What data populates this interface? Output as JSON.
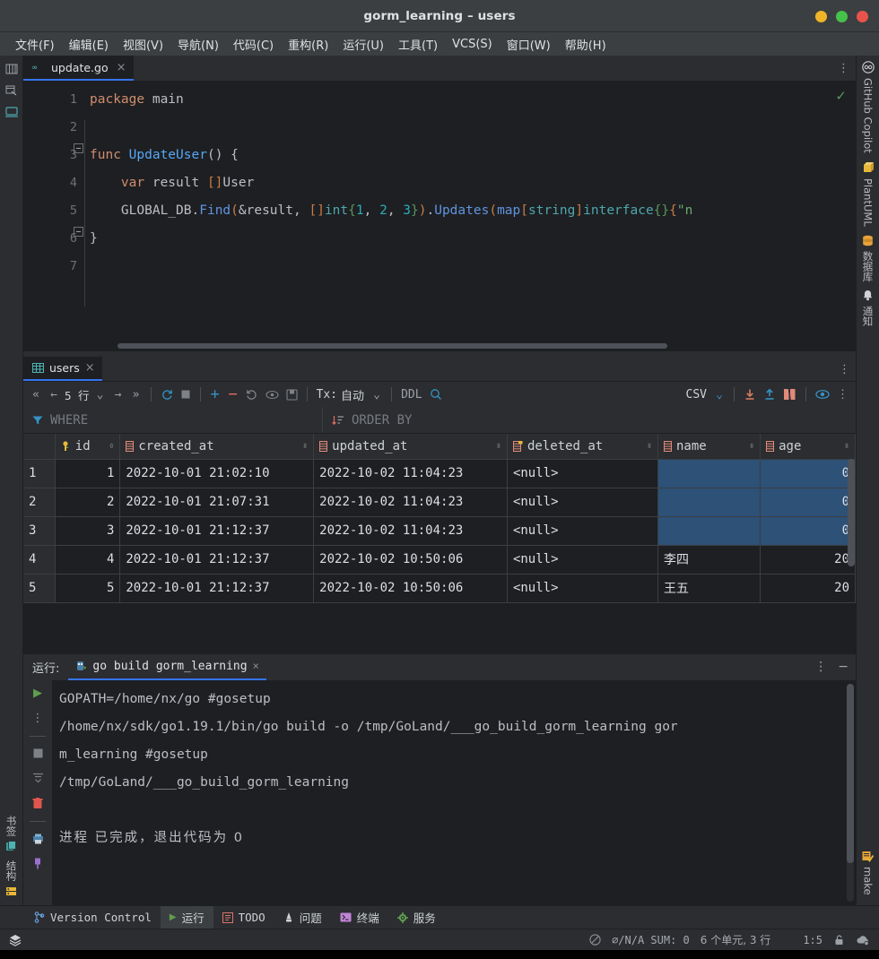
{
  "window": {
    "title": "gorm_learning – users",
    "buttons": [
      {
        "name": "minimize",
        "color": "#f0b429"
      },
      {
        "name": "maximize",
        "color": "#46c14a"
      },
      {
        "name": "close",
        "color": "#e8534c"
      }
    ]
  },
  "menu": [
    {
      "label": "文件(F)",
      "mnemonic": "F"
    },
    {
      "label": "编辑(E)",
      "mnemonic": "E"
    },
    {
      "label": "视图(V)",
      "mnemonic": "V"
    },
    {
      "label": "导航(N)",
      "mnemonic": "N"
    },
    {
      "label": "代码(C)",
      "mnemonic": "C"
    },
    {
      "label": "重构(R)",
      "mnemonic": "R"
    },
    {
      "label": "运行(U)",
      "mnemonic": "U"
    },
    {
      "label": "工具(T)",
      "mnemonic": "T"
    },
    {
      "label": "VCS(S)",
      "mnemonic": "S"
    },
    {
      "label": "窗口(W)",
      "mnemonic": "W"
    },
    {
      "label": "帮助(H)",
      "mnemonic": "H"
    }
  ],
  "left_rail": {
    "top_icons": [
      "project-icon",
      "commit-icon",
      "terminal-icon"
    ],
    "bottom_tools": [
      {
        "label": "书签",
        "icon": "bookmarks-icon"
      },
      {
        "label": "结构",
        "icon": "structure-icon"
      }
    ]
  },
  "right_rail": {
    "tools": [
      {
        "label": "GitHub Copilot",
        "icon": "copilot-icon"
      },
      {
        "label": "PlantUML",
        "icon": "plantuml-icon"
      },
      {
        "label": "数据库",
        "icon": "database-icon"
      },
      {
        "label": "通知",
        "icon": "bell-icon"
      },
      {
        "label": "make",
        "icon": "make-icon"
      }
    ]
  },
  "editor": {
    "tab": {
      "label": "update.go",
      "icon": "go-file-icon",
      "close": "×"
    },
    "more": "⋮",
    "inspection_ok": "✓",
    "lines": [
      {
        "n": "1",
        "tokens": [
          {
            "t": "package ",
            "c": "kw"
          },
          {
            "t": "main",
            "c": "pl"
          }
        ]
      },
      {
        "n": "2",
        "tokens": []
      },
      {
        "n": "3",
        "tokens": [
          {
            "t": "func ",
            "c": "kw"
          },
          {
            "t": "UpdateUser",
            "c": "fn"
          },
          {
            "t": "() {",
            "c": "br"
          }
        ],
        "fold": "open"
      },
      {
        "n": "4",
        "tokens": [
          {
            "t": "    ",
            "c": "pl"
          },
          {
            "t": "var ",
            "c": "kw"
          },
          {
            "t": "result ",
            "c": "pl"
          },
          {
            "t": "[]",
            "c": "or"
          },
          {
            "t": "User",
            "c": "pl"
          }
        ]
      },
      {
        "n": "5",
        "tokens": [
          {
            "t": "    GLOBAL_DB",
            "c": "pl"
          },
          {
            "t": ".",
            "c": "pl"
          },
          {
            "t": "Find",
            "c": "blue2"
          },
          {
            "t": "(",
            "c": "or"
          },
          {
            "t": "&result, ",
            "c": "pl"
          },
          {
            "t": "[]",
            "c": "or"
          },
          {
            "t": "int",
            "c": "teal"
          },
          {
            "t": "{",
            "c": "gr"
          },
          {
            "t": "1",
            "c": "num"
          },
          {
            "t": ", ",
            "c": "pl"
          },
          {
            "t": "2",
            "c": "num"
          },
          {
            "t": ", ",
            "c": "pl"
          },
          {
            "t": "3",
            "c": "num"
          },
          {
            "t": "}",
            "c": "gr"
          },
          {
            "t": ")",
            "c": "or"
          },
          {
            "t": ".",
            "c": "pl"
          },
          {
            "t": "Updates",
            "c": "blue2"
          },
          {
            "t": "(",
            "c": "or"
          },
          {
            "t": "map",
            "c": "blue2"
          },
          {
            "t": "[",
            "c": "or"
          },
          {
            "t": "string",
            "c": "teal"
          },
          {
            "t": "]",
            "c": "or"
          },
          {
            "t": "interface",
            "c": "teal"
          },
          {
            "t": "{}",
            "c": "gr"
          },
          {
            "t": "{",
            "c": "or"
          },
          {
            "t": "\"n",
            "c": "str"
          }
        ]
      },
      {
        "n": "6",
        "tokens": [
          {
            "t": "}",
            "c": "br"
          }
        ],
        "fold": "close"
      },
      {
        "n": "7",
        "tokens": []
      }
    ]
  },
  "database": {
    "tab": {
      "label": "users",
      "icon": "table-icon",
      "close": "×"
    },
    "more": "⋮",
    "toolbar": {
      "first_page": "«",
      "prev_page": "←",
      "row_count": "5 行",
      "row_count_chevron": "⌄",
      "next_page": "→",
      "last_page": "»",
      "reload": "reload-icon",
      "stop": "stop-icon",
      "add_row": "+",
      "delete_row": "−",
      "revert": "revert-icon",
      "view": "eye-icon",
      "save": "save-icon",
      "tx_label": "Tx:",
      "tx_value": "自动",
      "tx_chevron": "⌄",
      "ddl": "DDL",
      "search": "search-icon",
      "format_label": "CSV",
      "format_chevron": "⌄",
      "import": "download-icon",
      "export": "upload-icon",
      "compare": "compare-icon",
      "preview": "eye-open-icon",
      "overflow": "⋮"
    },
    "filters": {
      "where_icon": "filter-icon",
      "where_placeholder": "WHERE",
      "order_icon": "sort-icon",
      "order_placeholder": "ORDER BY"
    },
    "columns": [
      {
        "label": "id",
        "icon": "key-icon",
        "sortable": true
      },
      {
        "label": "created_at",
        "icon": "column-icon",
        "sortable": true
      },
      {
        "label": "updated_at",
        "icon": "column-icon",
        "sortable": true
      },
      {
        "label": "deleted_at",
        "icon": "index-column-icon",
        "sortable": true
      },
      {
        "label": "name",
        "icon": "column-icon",
        "sortable": true
      },
      {
        "label": "age",
        "icon": "column-icon",
        "sortable": true
      }
    ],
    "rows": [
      {
        "no": "1",
        "id": "1",
        "created_at": "2022-10-01 21:02:10",
        "updated_at": "2022-10-02 11:04:23",
        "deleted_at": "<null>",
        "name": "",
        "age": "0",
        "selected": true
      },
      {
        "no": "2",
        "id": "2",
        "created_at": "2022-10-01 21:07:31",
        "updated_at": "2022-10-02 11:04:23",
        "deleted_at": "<null>",
        "name": "",
        "age": "0",
        "selected": true
      },
      {
        "no": "3",
        "id": "3",
        "created_at": "2022-10-01 21:12:37",
        "updated_at": "2022-10-02 11:04:23",
        "deleted_at": "<null>",
        "name": "",
        "age": "0",
        "selected": true
      },
      {
        "no": "4",
        "id": "4",
        "created_at": "2022-10-01 21:12:37",
        "updated_at": "2022-10-02 10:50:06",
        "deleted_at": "<null>",
        "name": "李四",
        "age": "20",
        "selected": false
      },
      {
        "no": "5",
        "id": "5",
        "created_at": "2022-10-01 21:12:37",
        "updated_at": "2022-10-02 10:50:06",
        "deleted_at": "<null>",
        "name": "王五",
        "age": "20",
        "selected": false
      }
    ]
  },
  "run": {
    "label": "运行:",
    "config_tab": {
      "label": "go build gorm_learning",
      "icon": "go-run-icon",
      "close": "×"
    },
    "options": "⋮",
    "minimize": "−",
    "rail": [
      "rerun-icon",
      "more-icon",
      "stop-icon",
      "scroll-end-icon",
      "trash-icon",
      "print-icon",
      "pin-icon"
    ],
    "console_lines": [
      {
        "text": "GOPATH=/home/nx/go #gosetup",
        "cjk": false
      },
      {
        "text": "/home/nx/sdk/go1.19.1/bin/go build -o /tmp/GoLand/___go_build_gorm_learning gor",
        "cjk": false
      },
      {
        "text": "m_learning #gosetup",
        "cjk": false
      },
      {
        "text": "/tmp/GoLand/___go_build_gorm_learning",
        "cjk": false
      },
      {
        "text": "",
        "cjk": false
      },
      {
        "text": "进程 已完成，退出代码为 0",
        "cjk": true
      }
    ]
  },
  "tool_window_bar": [
    {
      "label": "Version Control",
      "icon": "vcs-icon",
      "active": false,
      "cjk": false
    },
    {
      "label": "运行",
      "icon": "run-icon",
      "active": true,
      "cjk": true
    },
    {
      "label": "TODO",
      "icon": "todo-icon",
      "active": false,
      "cjk": false
    },
    {
      "label": "问题",
      "icon": "problems-icon",
      "active": false,
      "cjk": true
    },
    {
      "label": "终端",
      "icon": "terminal-icon",
      "active": false,
      "cjk": true
    },
    {
      "label": "服务",
      "icon": "services-icon",
      "active": false,
      "cjk": false
    }
  ],
  "status_bar": {
    "left_icon": "layers-icon",
    "null_icon": "∅",
    "stats": "∅/N/A  SUM: 0",
    "cells": "6 个单元, 3 行",
    "caret": "1:5",
    "lock_icon": "lock-icon",
    "cloud_icon": "cloud-icon"
  },
  "colors": {
    "accent_blue": "#3574f0",
    "panel_bg": "#2b2d30",
    "editor_bg": "#1e1f22",
    "selection_blue": "#2d5177",
    "null_green": "#5e8c52",
    "titlebar_bg": "#3c3f41"
  }
}
